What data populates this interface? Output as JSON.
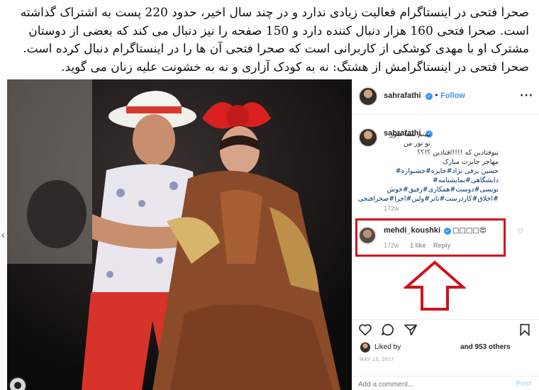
{
  "caption": {
    "lines": [
      "صحرا فتحی در اینستاگرام فعالیت زیادی ندارد و در چند سال اخیر، حدود 220 پست به اشتراک گذاشته",
      "است. صحرا فتحی 160 هزار دنبال کننده دارد و 150 صفحه را نیز دنبال می کند که بعضی از دوستان",
      "مشترک او با مهدی کوشکی از کاربرانی است که صحرا فتحی آن ها را در اینستاگرام دنبال کرده است.",
      "صحرا فتحی در اینستاگرامش از هشتگ: نه به کودک آزاری و نه به خشونت علیه زنان می گوید."
    ]
  },
  "post": {
    "author": "sahrafathi",
    "follow_label": "Follow",
    "separator": "•",
    "more_label": "···",
    "caption_lines": [
      "ببینم شما هنوز تو تور من",
      "نیوفتادین که !!!!افتادین ؟!؟؟",
      "مهاجر جایزت مبارک",
      "حسین برقی نژاد#جایزه#جشنواره#",
      "دانشگاهی#نمایشنامه#",
      "نویسی#دوست#همکاری#رفیق#خوش",
      "#اخلاق#کاردرست#تاتر#ولین#اجرا#صحرافتحی"
    ],
    "caption_age": "172w",
    "reply": {
      "author": "mehdi_koushki",
      "text": "□□□□😍",
      "age": "172w",
      "likes": "1 like",
      "reply_label": "Reply"
    },
    "liked_by_prefix": "Liked by",
    "liked_by_suffix": "and 953 others",
    "date": "MAY 13, 2017",
    "add_comment_placeholder": "Add a comment...",
    "post_label": "Post"
  },
  "icons": {
    "heart": "heart-icon",
    "comment": "comment-icon",
    "share": "share-icon",
    "save": "bookmark-icon",
    "verified": "verified-badge-icon"
  },
  "colors": {
    "link_blue": "#3897f0",
    "highlight_red": "#d1111b"
  }
}
